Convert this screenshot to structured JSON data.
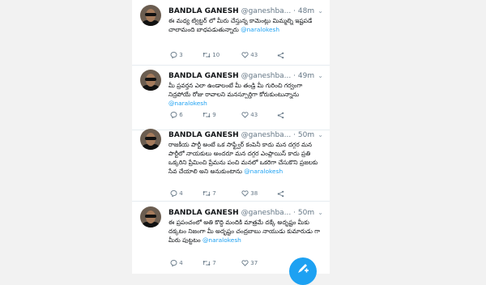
{
  "tweets": [
    {
      "name": "BANDLA GANESH",
      "handle": "@ganeshba...",
      "time": "48m",
      "text": "ఈ మధ్య ట్విట్టర్ లో మీరు చేస్తున్న కామెంట్లు మిమ్మల్ని ఇష్టపడే చాలామంది బాధపడుతున్నారు",
      "mention": "@naralokesh",
      "replies": "3",
      "retweets": "10",
      "likes": "43"
    },
    {
      "name": "BANDLA GANESH",
      "handle": "@ganeshba...",
      "time": "49m",
      "text": "మీ ప్రవర్తన ఎలా ఉండాలంటే మీ తండ్రి మీ గురించి గర్వంగా నిద్రపోయే రోజు రావాలని మనస్పూర్తిగా కోరుకుంటున్నాను",
      "mention": "@naralokesh",
      "replies": "6",
      "retweets": "9",
      "likes": "43"
    },
    {
      "name": "BANDLA GANESH",
      "handle": "@ganeshba...",
      "time": "50m",
      "text": "రాజకీయ పార్టీ అంటే ఒక సాఫ్ట్వేర్ కంపెనీ కాదు మన దగ్గర మన పార్టీలో నాయకులు అందరూ మన దగ్గర ఎంప్లాయిస్ కాదు ప్రతి ఒక్కరిని ప్రేమించి ప్రేమను పంచి మనలో ఒకరిగా చేసుకొని ప్రజలకు సేవ చేయాలి అని అనుకుంటాను",
      "mention": "@naralokesh",
      "replies": "4",
      "retweets": "7",
      "likes": "38"
    },
    {
      "name": "BANDLA GANESH",
      "handle": "@ganeshba...",
      "time": "50m",
      "text": "ఈ ప్రపంచంలో అతి కొద్ది మందికి మాత్రమే దక్కే అదృష్టం మీకు దక్కటం నిజంగా మీ అదృష్టం చంద్రబాబు నాయుడు కుమారుడు గా మీరు పుట్టటం",
      "mention": "@naralokesh",
      "replies": "4",
      "retweets": "7",
      "likes": "37"
    }
  ],
  "colors": {
    "accent": "#1da1f2",
    "text": "#14171a",
    "muted": "#657786"
  },
  "icons": {
    "reply": "reply-icon",
    "retweet": "retweet-icon",
    "like": "heart-icon",
    "share": "share-icon",
    "compose": "compose-tweet-icon"
  }
}
